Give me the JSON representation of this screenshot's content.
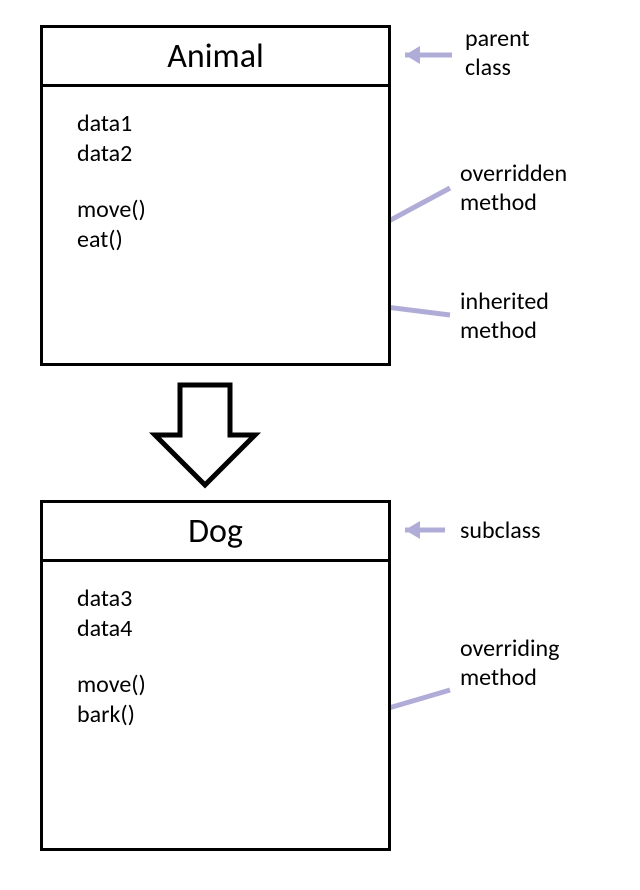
{
  "parent": {
    "title": "Animal",
    "fields": [
      "data1",
      "data2"
    ],
    "methods": [
      "move()",
      "eat()"
    ]
  },
  "child": {
    "title": "Dog",
    "fields": [
      "data3",
      "data4"
    ],
    "methods": [
      "move()",
      "bark()"
    ]
  },
  "labels": {
    "parent_class_1": "parent",
    "parent_class_2": "class",
    "overridden_1": "overridden",
    "overridden_2": "method",
    "inherited_1": "inherited",
    "inherited_2": "method",
    "subclass": "subclass",
    "overriding_1": "overriding",
    "overriding_2": "method"
  }
}
